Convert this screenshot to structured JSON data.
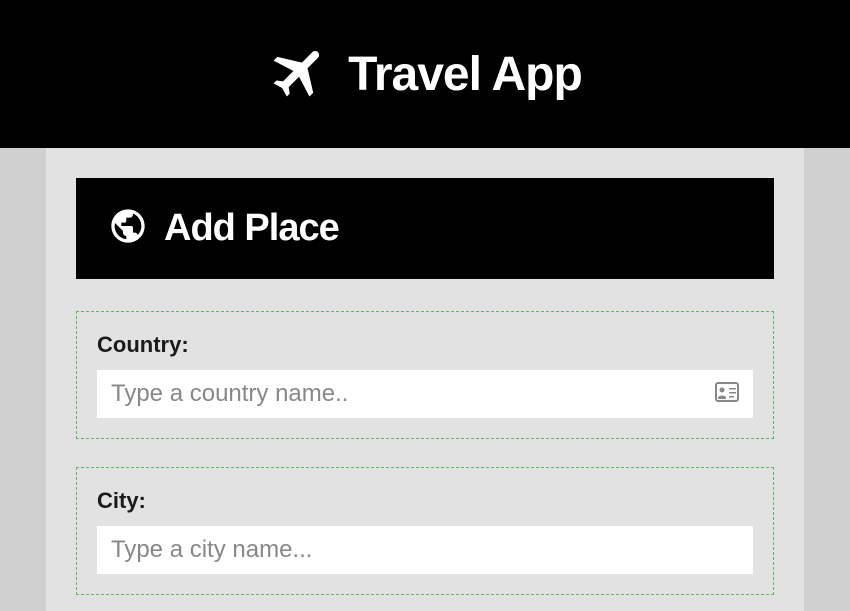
{
  "header": {
    "title": "Travel App"
  },
  "section": {
    "title": "Add Place"
  },
  "form": {
    "country": {
      "label": "Country:",
      "placeholder": "Type a country name..",
      "value": ""
    },
    "city": {
      "label": "City:",
      "placeholder": "Type a city name...",
      "value": ""
    }
  }
}
